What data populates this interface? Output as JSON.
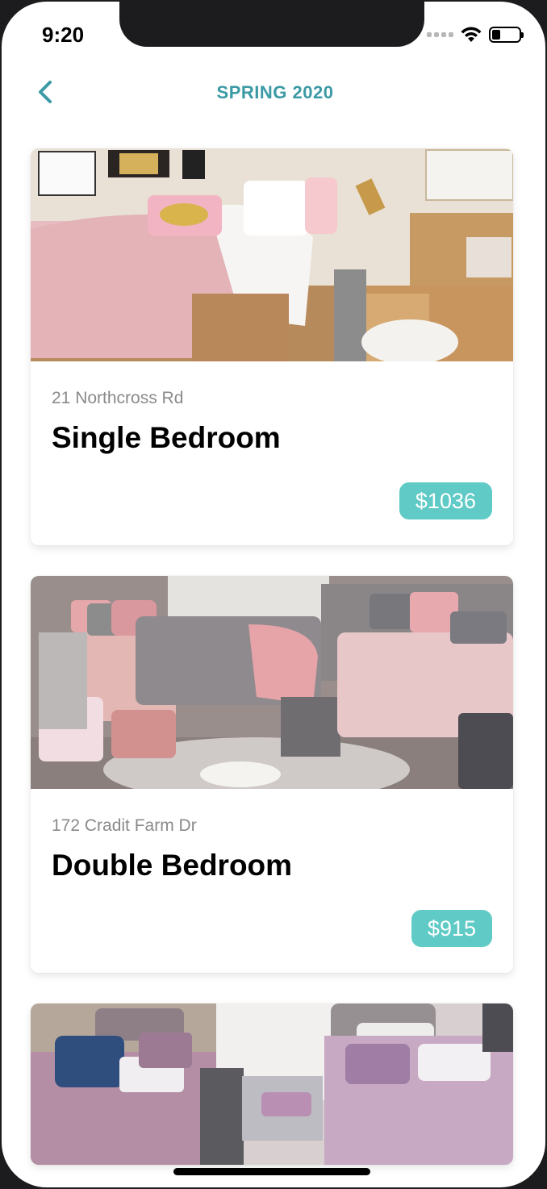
{
  "status_bar": {
    "time": "9:20"
  },
  "header": {
    "title": "SPRING 2020"
  },
  "listings": [
    {
      "address": "21 Northcross Rd",
      "title": "Single Bedroom",
      "price": "$1036"
    },
    {
      "address": "172 Cradit Farm Dr",
      "title": "Double Bedroom",
      "price": "$915"
    },
    {
      "address": "",
      "title": "",
      "price": ""
    }
  ],
  "colors": {
    "accent": "#3b9aa5",
    "badge": "#5fcac6"
  },
  "icons": {
    "back": "chevron-left-icon",
    "wifi": "wifi-icon",
    "battery": "battery-icon"
  }
}
